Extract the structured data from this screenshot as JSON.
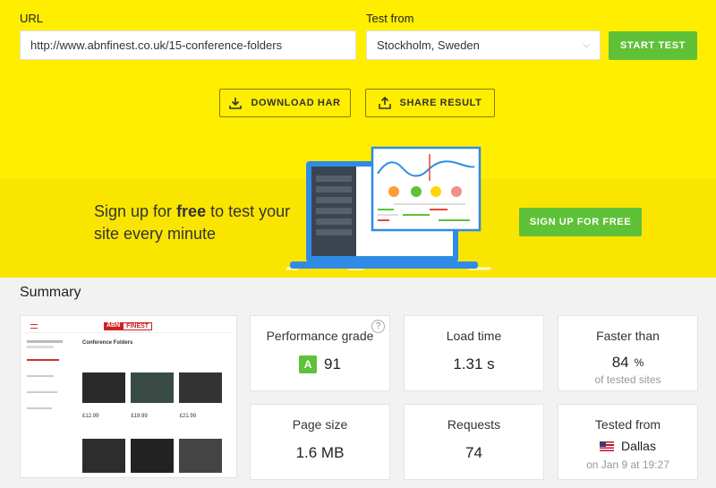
{
  "form": {
    "url_label": "URL",
    "url_value": "http://www.abnfinest.co.uk/15-conference-folders",
    "test_from_label": "Test from",
    "location_value": "Stockholm, Sweden",
    "start_button": "START TEST"
  },
  "actions": {
    "download_har": "DOWNLOAD HAR",
    "share_result": "SHARE RESULT"
  },
  "signup": {
    "text_before": "Sign up for ",
    "text_bold": "free",
    "text_after": " to test your site every minute",
    "button": "SIGN UP FOR FREE"
  },
  "summary": {
    "title": "Summary",
    "performance": {
      "label": "Performance grade",
      "grade": "A",
      "score": "91",
      "help": "?"
    },
    "load_time": {
      "label": "Load time",
      "value": "1.31 s"
    },
    "faster_than": {
      "label": "Faster than",
      "value": "84",
      "unit": "%",
      "sub": "of tested sites"
    },
    "page_size": {
      "label": "Page size",
      "value": "1.6 MB"
    },
    "requests": {
      "label": "Requests",
      "value": "74"
    },
    "tested_from": {
      "label": "Tested from",
      "city": "Dallas",
      "date": "on Jan 9 at 19:27"
    }
  },
  "screenshot": {
    "logo_left": "ABN",
    "logo_right": "FINEST",
    "heading": "Conference Folders",
    "prices": [
      "£12.99",
      "£19.99",
      "£21.99"
    ]
  },
  "colors": {
    "yellow": "#ffee00",
    "green": "#5fc138",
    "laptop_blue": "#2f8be6"
  },
  "icons": {
    "download": "download-icon",
    "share": "share-icon",
    "chevron": "chevron-down-icon",
    "flag": "us-flag-icon"
  }
}
